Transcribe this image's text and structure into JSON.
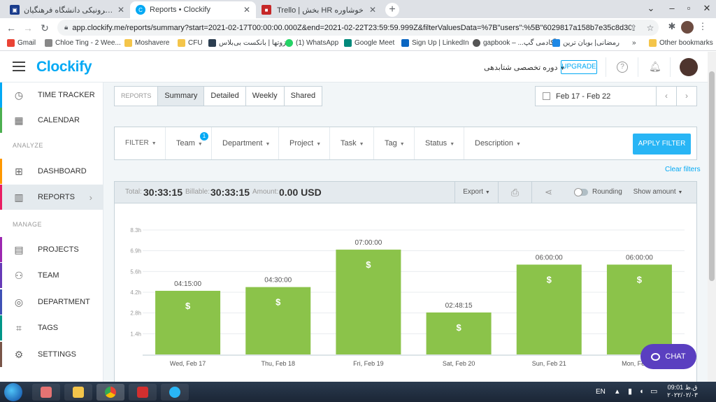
{
  "browser": {
    "tabs": [
      {
        "title": "سامانه آموزش الکترونیکی دانشگاه فرهنگیان",
        "color": "#1a3c8c"
      },
      {
        "title": "Reports • Clockify",
        "color": "#03a9f4"
      },
      {
        "title": "Trello | بخش HR خوشاوره",
        "color": "#c62828"
      }
    ],
    "url": "app.clockify.me/reports/summary?start=2021-02-17T00:00:00.000Z&end=2021-02-22T23:59:59.999Z&filterValuesData=%7B\"users\":%5B\"6029817a158b7e35c8d30969\"..."
  },
  "bookmarks": [
    {
      "label": "Gmail",
      "color": "#ea4335"
    },
    {
      "label": "Chloe Ting - 2 Wee...",
      "color": "#888888"
    },
    {
      "label": "Moshavere",
      "color": "#f4c54a"
    },
    {
      "label": "CFU",
      "color": "#f4c54a"
    },
    {
      "label": "ایزوتها | بانکست بی‌بلاس",
      "color": "#2c3e50"
    },
    {
      "label": "(1) WhatsApp",
      "color": "#25d366"
    },
    {
      "label": "Google Meet",
      "color": "#00897b"
    },
    {
      "label": "Sign Up | LinkedIn",
      "color": "#0a66c2"
    },
    {
      "label": "gapbook – ...آکادمی گپ",
      "color": "#555555"
    },
    {
      "label": "رمضانی| بوبان ترین",
      "color": "#1e88e5"
    }
  ],
  "other_bookmarks": "Other bookmarks",
  "header": {
    "logo": "Clockify",
    "workspace": "دوره تخصصی شتابدهی",
    "upgrade": "UPGRADE"
  },
  "sidebar": {
    "items": [
      {
        "label": "TIME TRACKER",
        "icon": "clock-icon",
        "stripe": "#03a9f4"
      },
      {
        "label": "CALENDAR",
        "icon": "calendar-icon",
        "stripe": "#4caf50"
      },
      {
        "label": "DASHBOARD",
        "icon": "dashboard-icon",
        "stripe": "#ff9800"
      },
      {
        "label": "REPORTS",
        "icon": "reports-icon",
        "stripe": "#e91e63"
      },
      {
        "label": "PROJECTS",
        "icon": "projects-icon",
        "stripe": "#9c27b0"
      },
      {
        "label": "TEAM",
        "icon": "team-icon",
        "stripe": "#673ab7"
      },
      {
        "label": "DEPARTMENT",
        "icon": "department-icon",
        "stripe": "#3f51b5"
      },
      {
        "label": "TAGS",
        "icon": "tags-icon",
        "stripe": "#009688"
      },
      {
        "label": "SETTINGS",
        "icon": "settings-icon",
        "stripe": "#795548"
      }
    ],
    "analyze_heading": "ANALYZE",
    "manage_heading": "MANAGE"
  },
  "report_tabs": {
    "label": "REPORTS",
    "tabs": [
      "Summary",
      "Detailed",
      "Weekly",
      "Shared"
    ],
    "selected": "Summary"
  },
  "date_range": "Feb 17 - Feb 22",
  "filters": {
    "label": "FILTER",
    "items": [
      "Team",
      "Department",
      "Project",
      "Task",
      "Tag",
      "Status",
      "Description"
    ],
    "team_badge": "1",
    "apply": "APPLY FILTER",
    "clear": "Clear filters"
  },
  "summary": {
    "total_label": "Total:",
    "total_value": "30:33:15",
    "billable_label": "Billable:",
    "billable_value": "30:33:15",
    "amount_label": "Amount:",
    "amount_value": "0.00 USD",
    "export": "Export",
    "rounding": "Rounding",
    "show_amount": "Show amount"
  },
  "chart_data": {
    "type": "bar",
    "categories": [
      "Wed, Feb 17",
      "Thu, Feb 18",
      "Fri, Feb 19",
      "Sat, Feb 20",
      "Sun, Feb 21",
      "Mon, Feb 22"
    ],
    "values": [
      4.25,
      4.5,
      7.0,
      2.8042,
      6.0,
      6.0
    ],
    "data_labels": [
      "04:15:00",
      "04:30:00",
      "07:00:00",
      "02:48:15",
      "06:00:00",
      "06:00:00"
    ],
    "y_ticks": [
      "1.4h",
      "2.8h",
      "4.2h",
      "5.6h",
      "6.9h",
      "8.3h"
    ],
    "y_tick_values": [
      1.385,
      2.77,
      4.155,
      5.54,
      6.925,
      8.31
    ],
    "ylim": [
      0,
      8.31
    ],
    "bar_color": "#8bc34a",
    "bar_symbol": "$",
    "grid": true
  },
  "chat": "CHAT",
  "taskbar": {
    "lang": "EN",
    "time": "09:01 ق.ظ",
    "date": "۲۰۲۲/۰۲/۰۳"
  }
}
